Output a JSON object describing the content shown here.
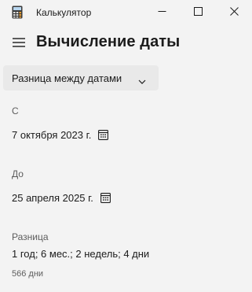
{
  "window": {
    "title": "Калькулятор"
  },
  "header": {
    "title": "Вычисление даты"
  },
  "mode": {
    "selected": "Разница между датами"
  },
  "from": {
    "label": "С",
    "date": "7 октября 2023 г."
  },
  "to": {
    "label": "До",
    "date": "25 апреля 2025 г."
  },
  "difference": {
    "label": "Разница",
    "value": "1 год; 6 мес.; 2 недель; 4 дни",
    "days": "566 дни"
  },
  "icons": {
    "app": "calculator-icon",
    "minimize": "minimize-icon",
    "maximize": "maximize-icon",
    "close": "close-icon",
    "menu": "hamburger-menu-icon",
    "dropdown": "chevron-down-icon",
    "calendar": "calendar-icon"
  }
}
